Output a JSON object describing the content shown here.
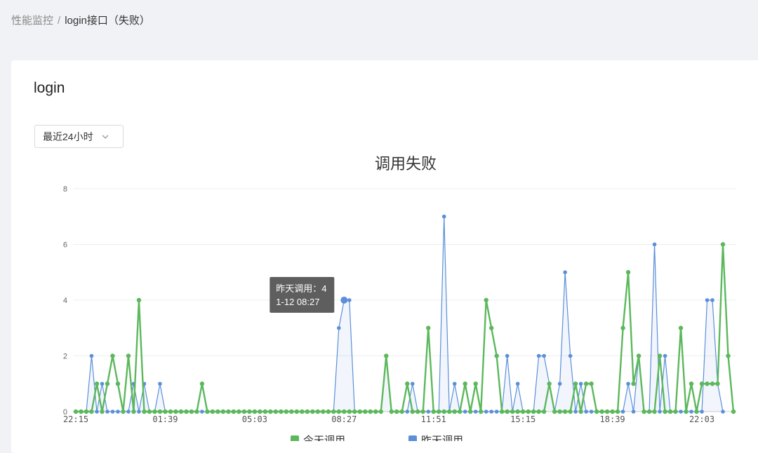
{
  "breadcrumb": {
    "parent": "性能监控",
    "separator": "/",
    "current": "login接口（失败）"
  },
  "card": {
    "title": "login",
    "range_select": {
      "value": "最近24小时",
      "icon": "chevron-down-icon"
    }
  },
  "chart_data": {
    "type": "line",
    "title": "调用失败",
    "ylim": [
      0,
      8
    ],
    "yticks": [
      "0",
      "2",
      "4",
      "6",
      "8"
    ],
    "xticks": [
      {
        "label": "22:15",
        "index": 0
      },
      {
        "label": "01:39",
        "index": 17
      },
      {
        "label": "05:03",
        "index": 34
      },
      {
        "label": "08:27",
        "index": 51
      },
      {
        "label": "11:51",
        "index": 68
      },
      {
        "label": "15:15",
        "index": 85
      },
      {
        "label": "18:39",
        "index": 102
      },
      {
        "label": "22:03",
        "index": 119
      }
    ],
    "grid": true,
    "legend_position": "bottom",
    "series": [
      {
        "name": "今天调用",
        "color": "#5cb85c",
        "fill": false,
        "values": [
          0,
          0,
          0,
          0,
          1,
          0,
          1,
          2,
          1,
          0,
          2,
          0,
          4,
          0,
          0,
          0,
          0,
          0,
          0,
          0,
          0,
          0,
          0,
          0,
          1,
          0,
          0,
          0,
          0,
          0,
          0,
          0,
          0,
          0,
          0,
          0,
          0,
          0,
          0,
          0,
          0,
          0,
          0,
          0,
          0,
          0,
          0,
          0,
          0,
          0,
          0,
          0,
          0,
          0,
          0,
          0,
          0,
          0,
          0,
          2,
          0,
          0,
          0,
          1,
          0,
          0,
          0,
          3,
          0,
          0,
          0,
          0,
          0,
          0,
          1,
          0,
          1,
          0,
          4,
          3,
          2,
          0,
          0,
          0,
          0,
          0,
          0,
          0,
          0,
          0,
          1,
          0,
          0,
          0,
          0,
          1,
          0,
          1,
          1,
          0,
          0,
          0,
          0,
          0,
          3,
          5,
          1,
          2,
          0,
          0,
          0,
          2,
          0,
          0,
          0,
          3,
          0,
          1,
          0,
          1,
          1,
          1,
          1,
          6,
          2,
          0
        ]
      },
      {
        "name": "昨天调用",
        "color": "#5b8fd9",
        "fill": true,
        "values": [
          0,
          0,
          0,
          2,
          0,
          1,
          0,
          0,
          0,
          0,
          0,
          1,
          0,
          1,
          0,
          0,
          1,
          0,
          0,
          0,
          0,
          0,
          0,
          0,
          0,
          0,
          0,
          0,
          0,
          0,
          0,
          0,
          0,
          0,
          0,
          0,
          0,
          0,
          0,
          0,
          0,
          0,
          0,
          0,
          0,
          0,
          0,
          0,
          0,
          0,
          3,
          4,
          4,
          0,
          0,
          0,
          0,
          0,
          0,
          2,
          0,
          0,
          0,
          0,
          1,
          0,
          0,
          0,
          0,
          0,
          7,
          0,
          1,
          0,
          0,
          0,
          0,
          0,
          0,
          0,
          0,
          0,
          2,
          0,
          1,
          0,
          0,
          0,
          2,
          2,
          1,
          0,
          1,
          5,
          2,
          0,
          1,
          0,
          0,
          0,
          0,
          0,
          0,
          0,
          0,
          1,
          0,
          2,
          0,
          0,
          6,
          0,
          2,
          0,
          0,
          0,
          0,
          0,
          0,
          0,
          4,
          4,
          1,
          0
        ]
      }
    ],
    "tooltip": {
      "series_label": "昨天调用",
      "separator": "：",
      "value": "4",
      "time": "1-12 08:27",
      "index": 51
    }
  }
}
